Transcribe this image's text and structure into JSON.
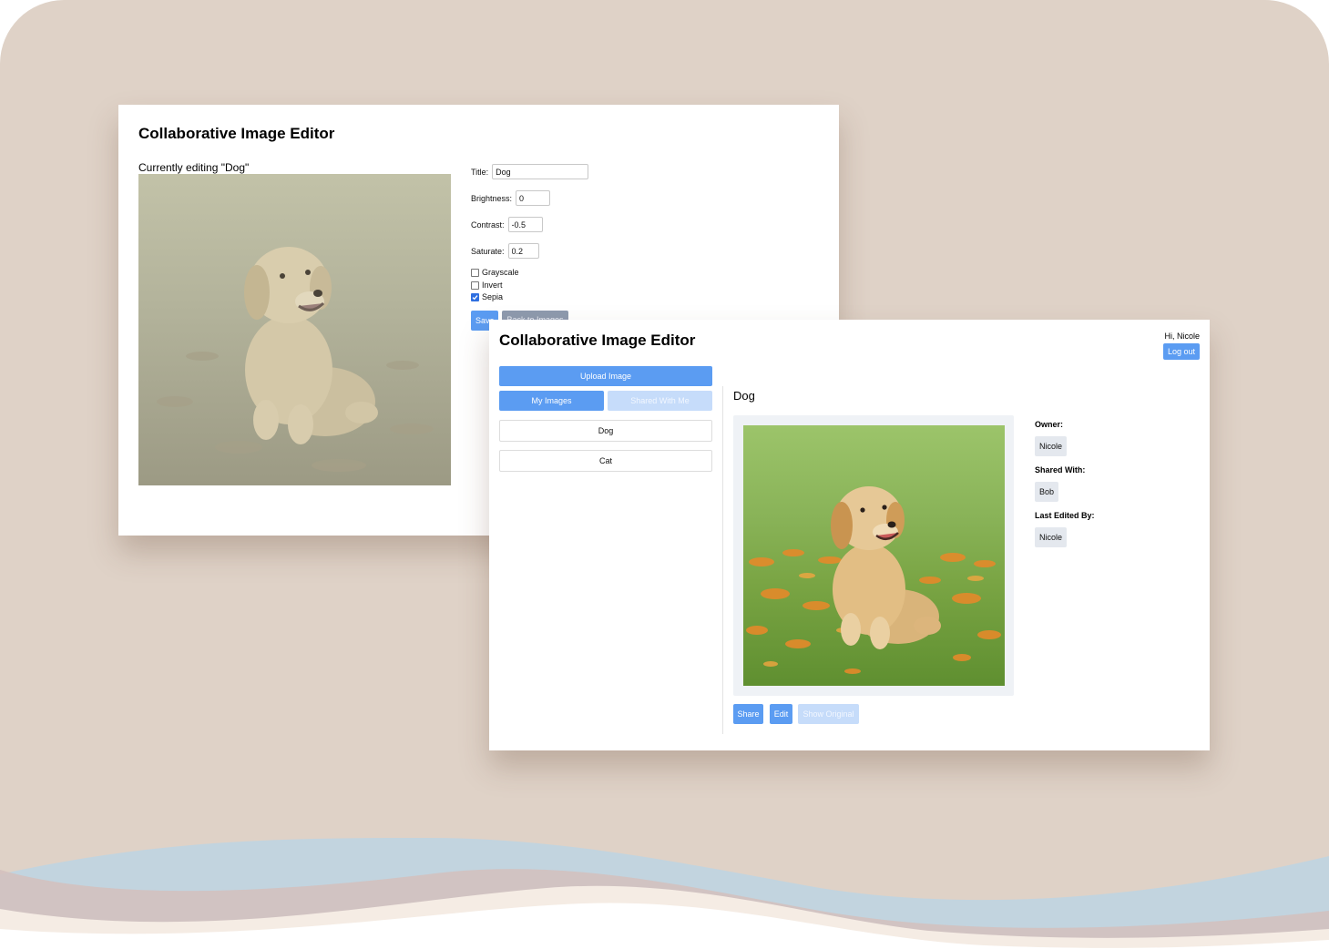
{
  "colors": {
    "background": "#dfd2c7",
    "primary_button": "#5b9cf2",
    "disabled_button": "#c6dcfa",
    "secondary_button": "#8e9aae",
    "chip": "#e4e8ee"
  },
  "editor": {
    "title": "Collaborative Image Editor",
    "currently_editing_prefix": "Currently editing ",
    "currently_editing_name": "\"Dog\"",
    "fields": {
      "title_label": "Title:",
      "title_value": "Dog",
      "brightness_label": "Brightness:",
      "brightness_value": "0",
      "contrast_label": "Contrast:",
      "contrast_value": "-0.5",
      "saturate_label": "Saturate:",
      "saturate_value": "0.2"
    },
    "filters": [
      {
        "label": "Grayscale",
        "checked": false
      },
      {
        "label": "Invert",
        "checked": false
      },
      {
        "label": "Sepia",
        "checked": true
      }
    ],
    "save_label": "Save",
    "back_label": "Back to Images"
  },
  "gallery": {
    "title": "Collaborative Image Editor",
    "greeting": "Hi, Nicole",
    "logout_label": "Log out",
    "upload_label": "Upload Image",
    "tabs": {
      "mine": "My Images",
      "shared": "Shared With Me"
    },
    "images": [
      "Dog",
      "Cat"
    ],
    "selected_title": "Dog",
    "owner_label": "Owner:",
    "owner": "Nicole",
    "shared_label": "Shared With:",
    "shared_with": "Bob",
    "last_edited_label": "Last Edited By:",
    "last_edited_by": "Nicole",
    "actions": {
      "share": "Share",
      "edit": "Edit",
      "show_original": "Show Original"
    }
  }
}
